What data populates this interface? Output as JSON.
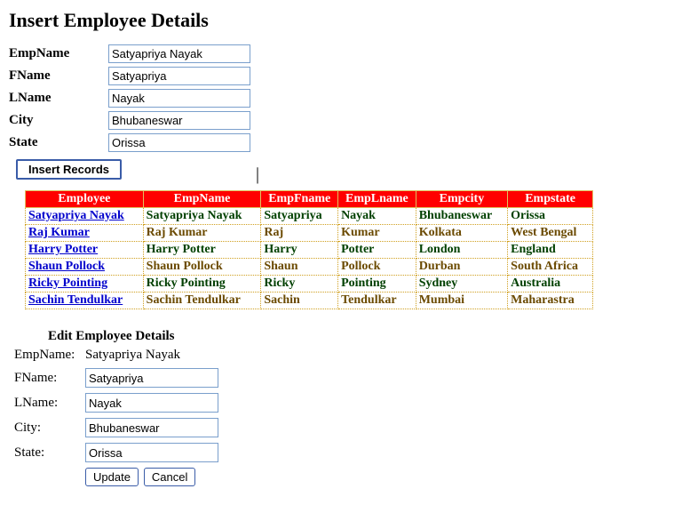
{
  "insertForm": {
    "title": "Insert Employee Details",
    "labels": {
      "empName": "EmpName",
      "fName": "FName",
      "lName": "LName",
      "city": "City",
      "state": "State"
    },
    "values": {
      "empName": "Satyapriya Nayak",
      "fName": "Satyapriya",
      "lName": "Nayak",
      "city": "Bhubaneswar",
      "state": "Orissa"
    },
    "button": "Insert Records"
  },
  "grid": {
    "headers": [
      "Employee",
      "EmpName",
      "EmpFname",
      "EmpLname",
      "Empcity",
      "Empstate"
    ],
    "rows": [
      {
        "link": "Satyapriya Nayak",
        "name": "Satyapriya Nayak",
        "fname": "Satyapriya",
        "lname": "Nayak",
        "city": "Bhubaneswar",
        "state": "Orissa"
      },
      {
        "link": "Raj Kumar",
        "name": "Raj Kumar",
        "fname": "Raj",
        "lname": "Kumar",
        "city": "Kolkata",
        "state": "West Bengal"
      },
      {
        "link": "Harry Potter",
        "name": "Harry Potter",
        "fname": "Harry",
        "lname": "Potter",
        "city": "London",
        "state": "England"
      },
      {
        "link": "Shaun Pollock",
        "name": "Shaun Pollock",
        "fname": "Shaun",
        "lname": "Pollock",
        "city": "Durban",
        "state": "South Africa"
      },
      {
        "link": "Ricky Pointing",
        "name": "Ricky Pointing",
        "fname": "Ricky",
        "lname": "Pointing",
        "city": "Sydney",
        "state": "Australia"
      },
      {
        "link": "Sachin Tendulkar",
        "name": "Sachin Tendulkar",
        "fname": "Sachin",
        "lname": "Tendulkar",
        "city": "Mumbai",
        "state": "Maharastra"
      }
    ]
  },
  "editForm": {
    "title": "Edit Employee Details",
    "labels": {
      "empName": "EmpName:",
      "fName": "FName:",
      "lName": "LName:",
      "city": "City:",
      "state": "State:"
    },
    "empName": "Satyapriya Nayak",
    "values": {
      "fName": "Satyapriya",
      "lName": "Nayak",
      "city": "Bhubaneswar",
      "state": "Orissa"
    },
    "updateBtn": "Update",
    "cancelBtn": "Cancel"
  }
}
